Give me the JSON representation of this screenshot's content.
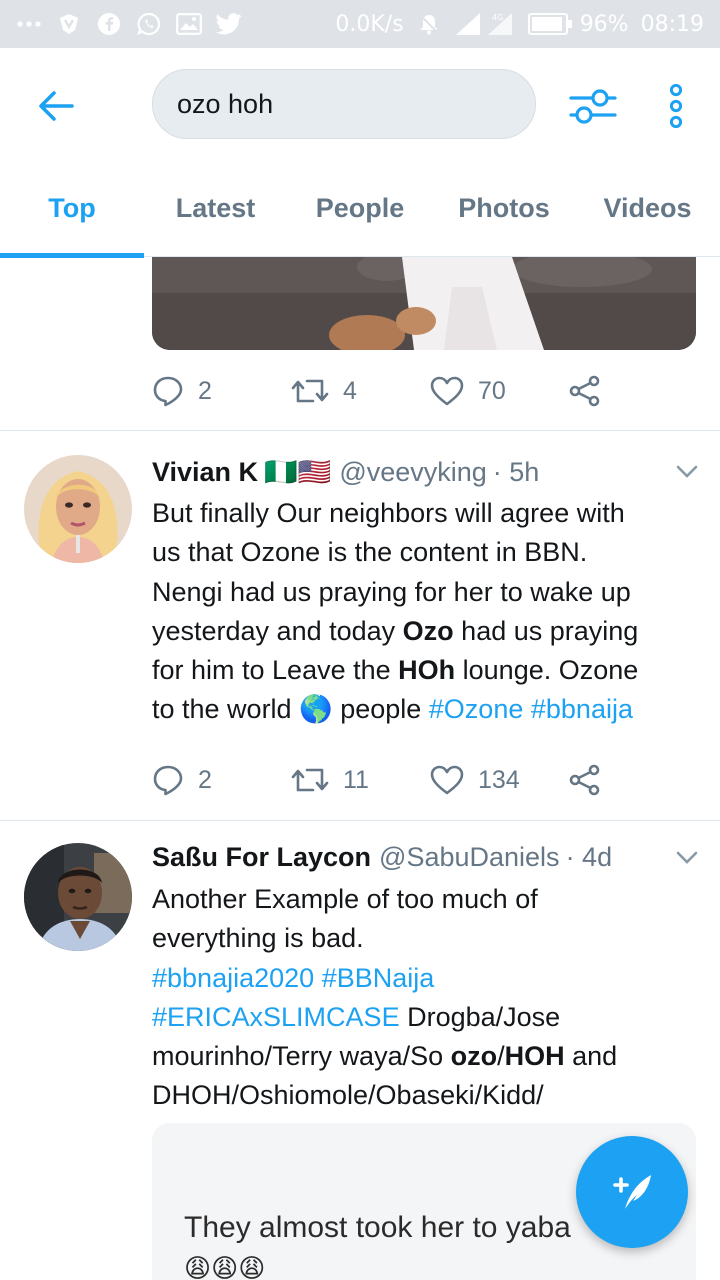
{
  "status_bar": {
    "network_speed": "0.0K/s",
    "network_type": "4G",
    "battery_percent": "96%",
    "battery_level": 0.96,
    "time": "08:19",
    "icons": [
      "more-dots-icon",
      "vpn-icon",
      "facebook-icon",
      "whatsapp-icon",
      "gallery-icon",
      "twitter-icon",
      "alarm-icon",
      "signal-icon",
      "battery-icon"
    ]
  },
  "header": {
    "search_value": "ozo hoh",
    "icons": [
      "back-arrow-icon",
      "filter-sliders-icon",
      "vertical-dots-icon"
    ]
  },
  "tabs": [
    {
      "label": "Top",
      "active": true
    },
    {
      "label": "Latest",
      "active": false
    },
    {
      "label": "People",
      "active": false
    },
    {
      "label": "Photos",
      "active": false
    },
    {
      "label": "Videos",
      "active": false
    }
  ],
  "previous_tweet": {
    "replies": "2",
    "retweets": "4",
    "likes": "70"
  },
  "tweets": [
    {
      "name": "Vivian K",
      "flags": "🇳🇬🇺🇸",
      "handle": "@veevyking",
      "time": "· 5h",
      "lines": [
        [
          {
            "t": "But finally Our neighbors will agree with",
            "s": ""
          }
        ],
        [
          {
            "t": "us that Ozone is the content in BBN.",
            "s": ""
          }
        ],
        [
          {
            "t": "Nengi had us praying for her to wake up",
            "s": ""
          }
        ],
        [
          {
            "t": "yesterday and today ",
            "s": ""
          },
          {
            "t": "Ozo",
            "s": "hl"
          },
          {
            "t": " had us praying",
            "s": ""
          }
        ],
        [
          {
            "t": "for him to Leave the ",
            "s": ""
          },
          {
            "t": "HOh",
            "s": "hl"
          },
          {
            "t": " lounge. Ozone",
            "s": ""
          }
        ],
        [
          {
            "t": "to the world 🌎 people ",
            "s": ""
          },
          {
            "t": "#Ozone",
            "s": "tag"
          },
          {
            "t": " ",
            "s": ""
          },
          {
            "t": "#bbnaija",
            "s": "tag"
          }
        ]
      ],
      "replies": "2",
      "retweets": "11",
      "likes": "134"
    },
    {
      "name": "Saßu For Laycon",
      "handle": "@SabuDaniels",
      "time": "· 4d",
      "lines": [
        [
          {
            "t": "Another Example of too much of",
            "s": ""
          }
        ],
        [
          {
            "t": "everything is bad.",
            "s": ""
          }
        ],
        [
          {
            "t": "#bbnajia2020",
            "s": "tag"
          },
          {
            "t": " ",
            "s": ""
          },
          {
            "t": "#BBNaija",
            "s": "tag"
          }
        ],
        [
          {
            "t": "#ERICAxSLIMCASE",
            "s": "tag"
          },
          {
            "t": " Drogba/Jose",
            "s": ""
          }
        ],
        [
          {
            "t": "mourinho/Terry waya/So ",
            "s": ""
          },
          {
            "t": "ozo",
            "s": "hl"
          },
          {
            "t": "/",
            "s": ""
          },
          {
            "t": "HOH",
            "s": "hl"
          },
          {
            "t": " and",
            "s": ""
          }
        ],
        [
          {
            "t": "DHOH/Oshiomole/Obaseki/Kidd/",
            "s": ""
          }
        ]
      ],
      "media_caption": "They almost took her to yaba",
      "media_emoji": "😩😩😩"
    }
  ],
  "fab": {
    "icon": "compose-feather-icon"
  },
  "colors": {
    "accent": "#1da1f2",
    "secondary_text": "#657786",
    "status_bar_bg": "#dfe3e8"
  }
}
